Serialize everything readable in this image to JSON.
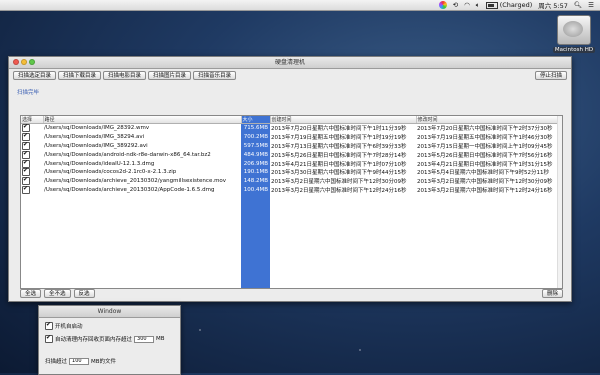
{
  "menubar": {
    "charge": "(Charged)",
    "clock": "周六 5:57"
  },
  "desktop": {
    "hd_label": "Macintosh HD"
  },
  "main_window": {
    "title": "硬盘清理机",
    "toolbar": [
      {
        "label": "扫描选定目录"
      },
      {
        "label": "扫描下载目录"
      },
      {
        "label": "扫描电影目录"
      },
      {
        "label": "扫描图片目录"
      },
      {
        "label": "扫描音乐目录"
      }
    ],
    "stop_label": "停止扫描",
    "status": "扫描完毕",
    "columns": {
      "select": "选择",
      "path": "路径",
      "size": "大小",
      "created": "创建时间",
      "modified": "修改时间"
    },
    "rows": [
      {
        "path": "/Users/sq/Downloads/IMG_28392.wmv",
        "size": "715.6MB",
        "created": "2013年7月20日星期六中国标准时间下午1时11分39秒",
        "modified": "2013年7月20日星期六中国标准时间下午2时37分30秒",
        "checked": true
      },
      {
        "path": "/Users/sq/Downloads/IMG_38294.avi",
        "size": "700.2MB",
        "created": "2013年7月19日星期五中国标准时间下午1时19分19秒",
        "modified": "2013年7月19日星期五中国标准时间下午1时46分30秒",
        "checked": true
      },
      {
        "path": "/Users/sq/Downloads/IMG_389292.avi",
        "size": "597.5MB",
        "created": "2013年7月13日星期六中国标准时间下午6时39分33秒",
        "modified": "2013年7月15日星期一中国标准时间上午1时09分45秒",
        "checked": true
      },
      {
        "path": "/Users/sq/Downloads/android-ndk-r8e-darwin-x86_64.tar.bz2",
        "size": "484.9MB",
        "created": "2013年5月26日星期日中国标准时间下午7时28分14秒",
        "modified": "2013年5月26日星期日中国标准时间下午7时56分16秒",
        "checked": true
      },
      {
        "path": "/Users/sq/Downloads/ideaIU-12.1.3.dmg",
        "size": "206.9MB",
        "created": "2013年4月21日星期日中国标准时间下午1时07分10秒",
        "modified": "2013年4月21日星期日中国标准时间下午1时31分15秒",
        "checked": true
      },
      {
        "path": "/Users/sq/Downloads/cocos2d-2.1rc0-x-2.1.3.zip",
        "size": "190.1MB",
        "created": "2013年3月30日星期六中国标准时间下午9时44分15秒",
        "modified": "2013年5月4日星期六中国标准时间下午9时52分11秒",
        "checked": true
      },
      {
        "path": "/Users/sq/Downloads/archieve_20130302/yangmillsexistence.mov",
        "size": "148.2MB",
        "created": "2013年3月2日星期六中国标准时间下午12时30分09秒",
        "modified": "2013年3月2日星期六中国标准时间下午12时30分09秒",
        "checked": true
      },
      {
        "path": "/Users/sq/Downloads/archieve_20130302/AppCode-1.6.5.dmg",
        "size": "100.4MB",
        "created": "2013年3月2日星期六中国标准时间下午12时24分16秒",
        "modified": "2013年3月2日星期六中国标准时间下午12时24分16秒",
        "checked": true
      }
    ],
    "empty_row_count": 14,
    "bottom": {
      "select_all": "全选",
      "select_none": "全不选",
      "invert": "反选",
      "delete": "删除"
    }
  },
  "prefs_window": {
    "title": "Window",
    "launch_at_login": "开机自启动",
    "auto_clean_label": "自动清理内存回收页面内存超过",
    "auto_clean_value": "300",
    "auto_clean_unit": "MB",
    "scan_over_label": "扫描超过",
    "scan_over_value": "100",
    "scan_over_unit": "MB的文件"
  }
}
